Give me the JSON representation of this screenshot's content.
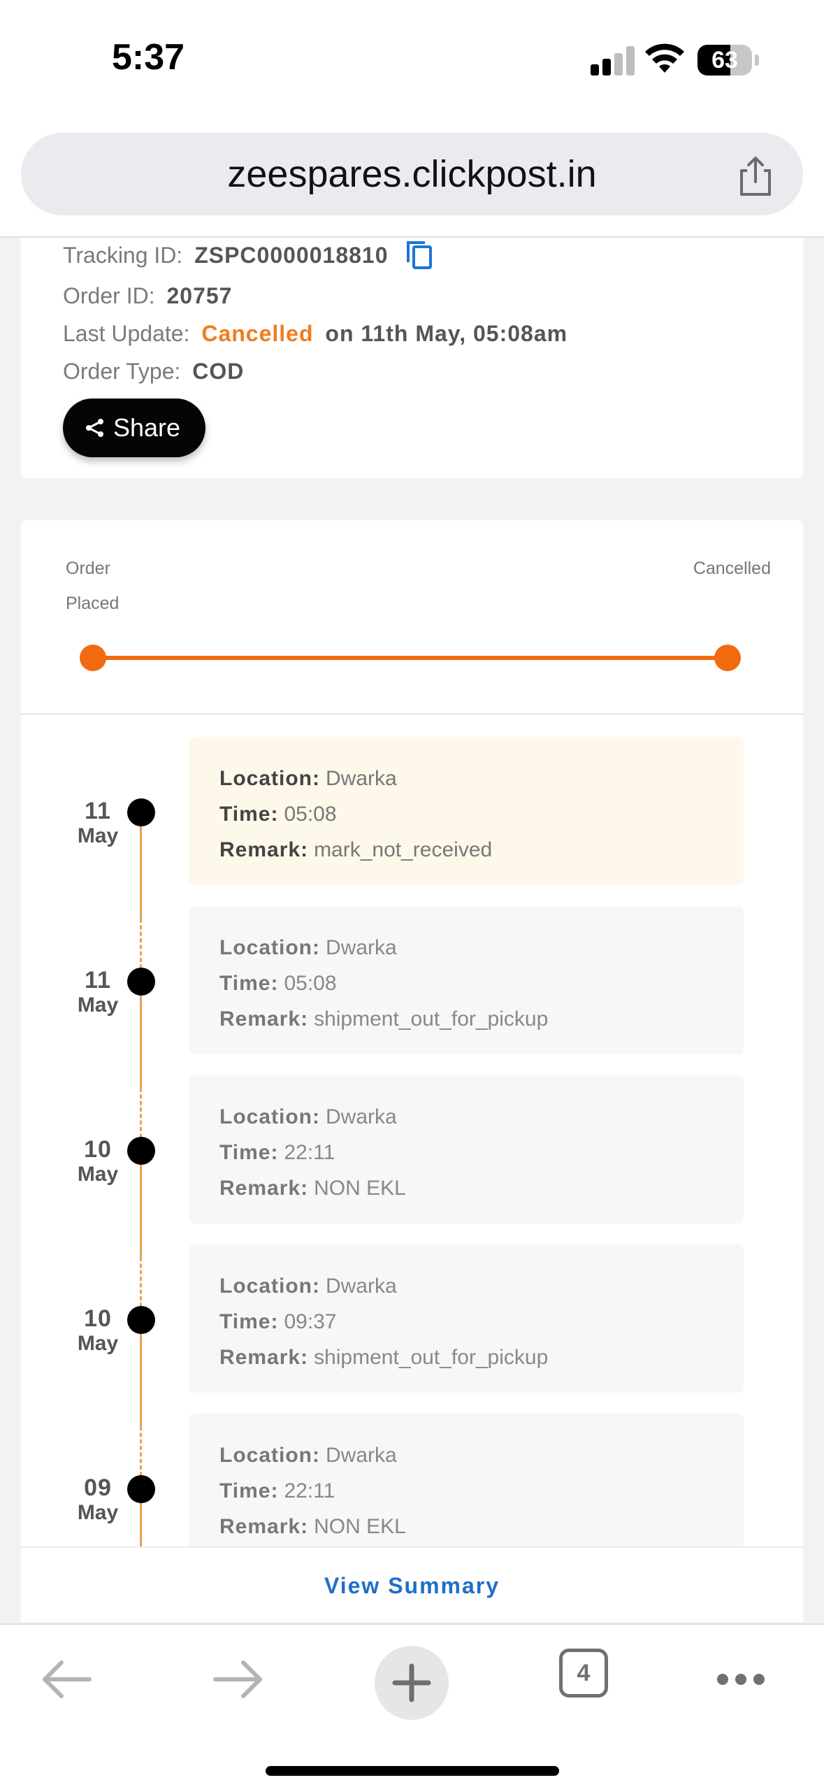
{
  "status_bar": {
    "time": "5:37",
    "battery": "63"
  },
  "browser": {
    "url": "zeespares.clickpost.in",
    "tabs_count": "4"
  },
  "order_info": {
    "tracking_label": "Tracking ID:",
    "tracking_id": "ZSPC0000018810",
    "order_label": "Order ID:",
    "order_id": "20757",
    "last_update_label": "Last Update:",
    "last_update_status": "Cancelled",
    "last_update_time": "on 11th May, 05:08am",
    "order_type_label": "Order Type:",
    "order_type": "COD",
    "share_label": "Share"
  },
  "progress": {
    "start_label": "Order Placed",
    "end_label": "Cancelled",
    "accent_color": "#f26a10"
  },
  "timeline": {
    "location_label": "Location:",
    "time_label": "Time:",
    "remark_label": "Remark:",
    "events": [
      {
        "day": "11",
        "month": "May",
        "location": "Dwarka",
        "time": "05:08",
        "remark": "mark_not_received"
      },
      {
        "day": "11",
        "month": "May",
        "location": "Dwarka",
        "time": "05:08",
        "remark": "shipment_out_for_pickup"
      },
      {
        "day": "10",
        "month": "May",
        "location": "Dwarka",
        "time": "22:11",
        "remark": "NON EKL"
      },
      {
        "day": "10",
        "month": "May",
        "location": "Dwarka",
        "time": "09:37",
        "remark": "shipment_out_for_pickup"
      },
      {
        "day": "09",
        "month": "May",
        "location": "Dwarka",
        "time": "22:11",
        "remark": "NON EKL"
      }
    ]
  },
  "view_summary_label": "View Summary"
}
